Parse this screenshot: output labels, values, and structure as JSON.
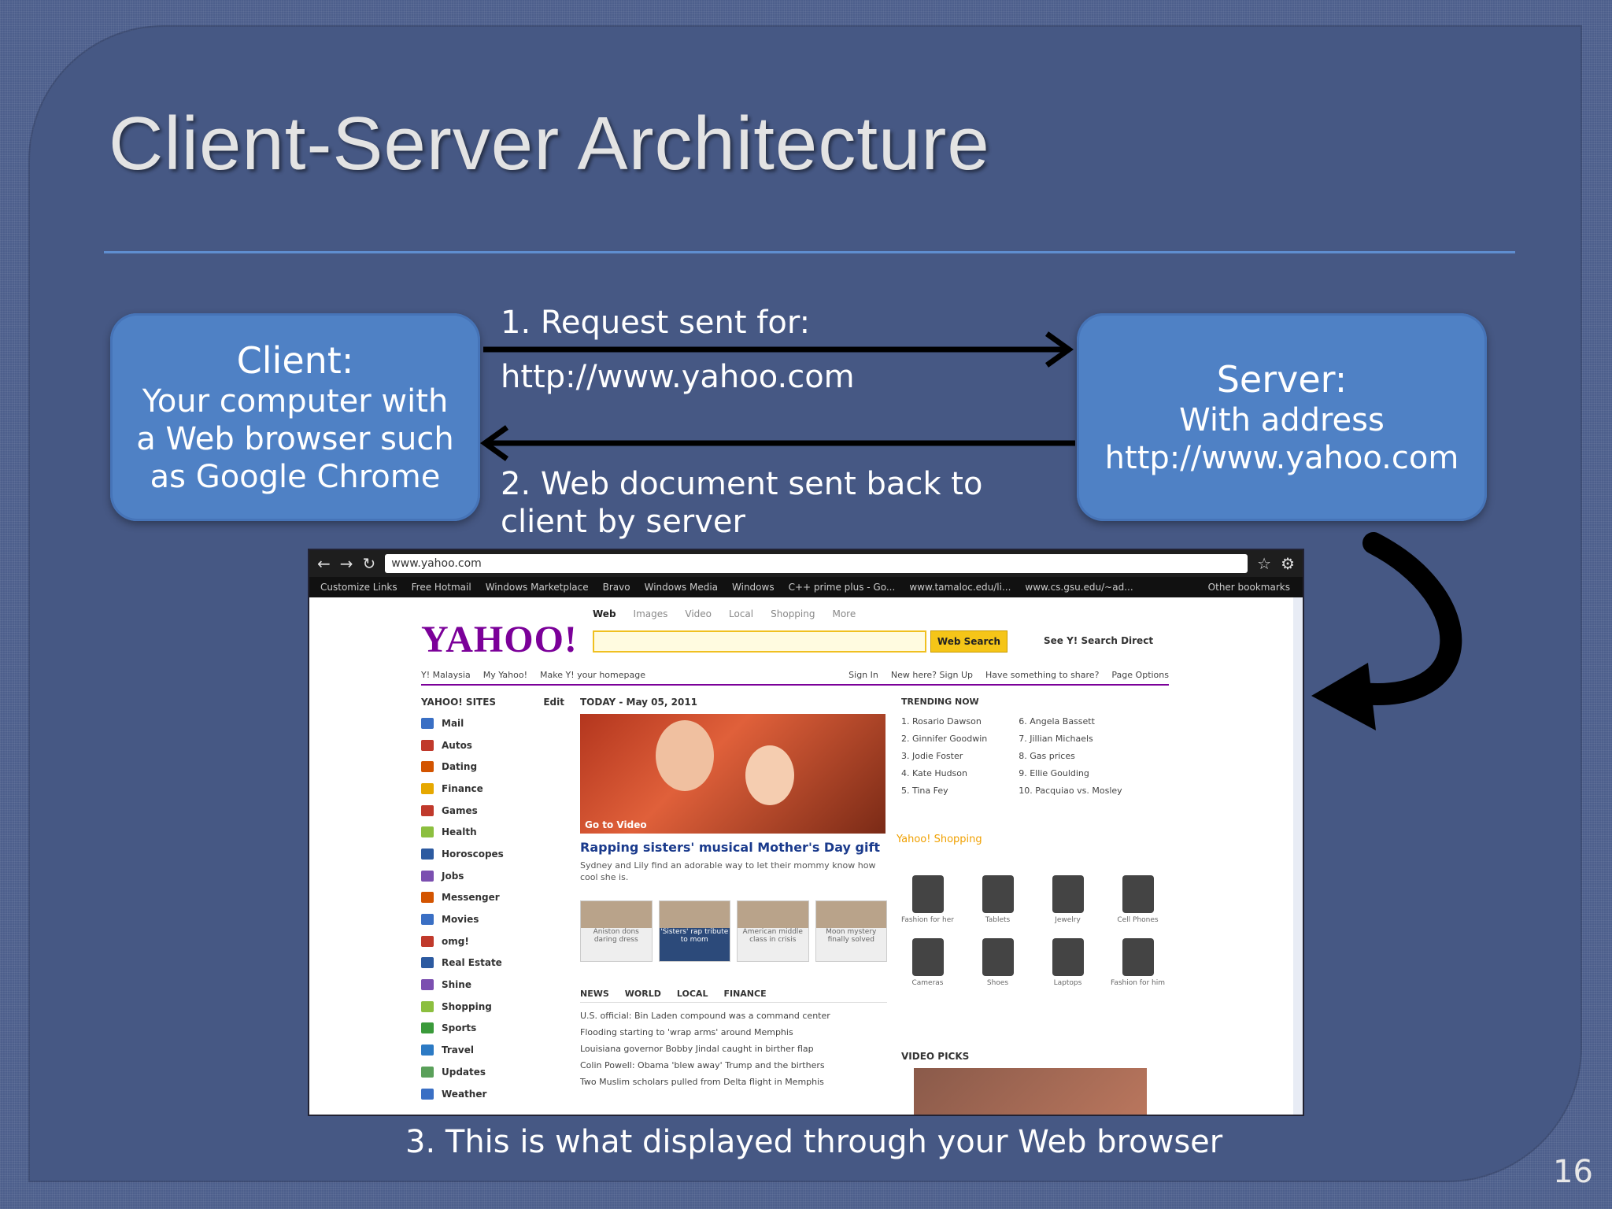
{
  "slide": {
    "title": "Client-Server Architecture",
    "page_number": "16",
    "caption": "3. This is what displayed through your Web browser"
  },
  "client": {
    "heading": "Client:",
    "lines": [
      "Your computer with",
      "a Web browser such",
      "as Google Chrome"
    ]
  },
  "server": {
    "heading": "Server:",
    "lines": [
      "With address",
      "http://www.yahoo.com"
    ]
  },
  "request": {
    "line1": "1. Request sent for:",
    "line2": "http://www.yahoo.com"
  },
  "response": {
    "line1": "2. Web document sent back to",
    "line2": "client by server"
  },
  "browser": {
    "url": "www.yahoo.com",
    "bookmarks": [
      "Customize Links",
      "Free Hotmail",
      "Windows Marketplace",
      "Bravo",
      "Windows Media",
      "Windows",
      "C++ prime plus - Go...",
      "www.tamaloc.edu/li...",
      "www.cs.gsu.edu/~ad..."
    ],
    "other_bookmarks": "Other bookmarks",
    "yahoo": {
      "logo": "YAHOO!",
      "search_tabs": [
        "Web",
        "Images",
        "Video",
        "Local",
        "Shopping",
        "More"
      ],
      "search_button": "Web Search",
      "search_direct": "See Y! Search Direct",
      "bar": [
        "Y! Malaysia",
        "My Yahoo!",
        "Make Y! your homepage",
        "Sign In",
        "New here? Sign Up",
        "Have something to share?",
        "Page Options"
      ],
      "sites_header": "YAHOO! SITES",
      "sites_edit": "Edit",
      "sites": [
        "Mail",
        "Autos",
        "Dating",
        "Finance",
        "Games",
        "Health",
        "Horoscopes",
        "Jobs",
        "Messenger",
        "Movies",
        "omg!",
        "Real Estate",
        "Shine",
        "Shopping",
        "Sports",
        "Travel",
        "Updates",
        "Weather"
      ],
      "today_header": "TODAY - May 05, 2011",
      "go_to_video": "Go to Video",
      "headline": "Rapping sisters' musical Mother's Day gift",
      "blurb": "Sydney and Lily find an adorable way to let their mommy know how cool she is.",
      "thumbs": [
        "Aniston dons daring dress",
        "'Sisters' rap tribute to mom",
        "American middle class in crisis",
        "Moon mystery finally solved"
      ],
      "news_tabs": [
        "NEWS",
        "WORLD",
        "LOCAL",
        "FINANCE"
      ],
      "news": [
        "U.S. official: Bin Laden compound was a command center",
        "Flooding starting to 'wrap arms' around Memphis",
        "Louisiana governor Bobby Jindal caught in birther flap",
        "Colin Powell: Obama 'blew away' Trump and the birthers",
        "Two Muslim scholars pulled from Delta flight in Memphis"
      ],
      "trending_header": "TRENDING NOW",
      "trending_left": [
        "1. Rosario Dawson",
        "2. Ginnifer Goodwin",
        "3. Jodie Foster",
        "4. Kate Hudson",
        "5. Tina Fey"
      ],
      "trending_right": [
        "6. Angela Bassett",
        "7. Jillian Michaels",
        "8. Gas prices",
        "9. Ellie Goulding",
        "10. Pacquiao vs. Mosley"
      ],
      "shopping_header": "Yahoo! Shopping",
      "shopping_items": [
        "Fashion for her",
        "Tablets",
        "Jewelry",
        "Cell Phones",
        "Cameras",
        "Shoes",
        "Laptops",
        "Fashion for him"
      ],
      "video_picks": "VIDEO PICKS"
    }
  },
  "colors": {
    "background": "#465884",
    "box": "#4f81c5",
    "rule": "#5f8ed0",
    "yahoo_purple": "#7b0099"
  }
}
